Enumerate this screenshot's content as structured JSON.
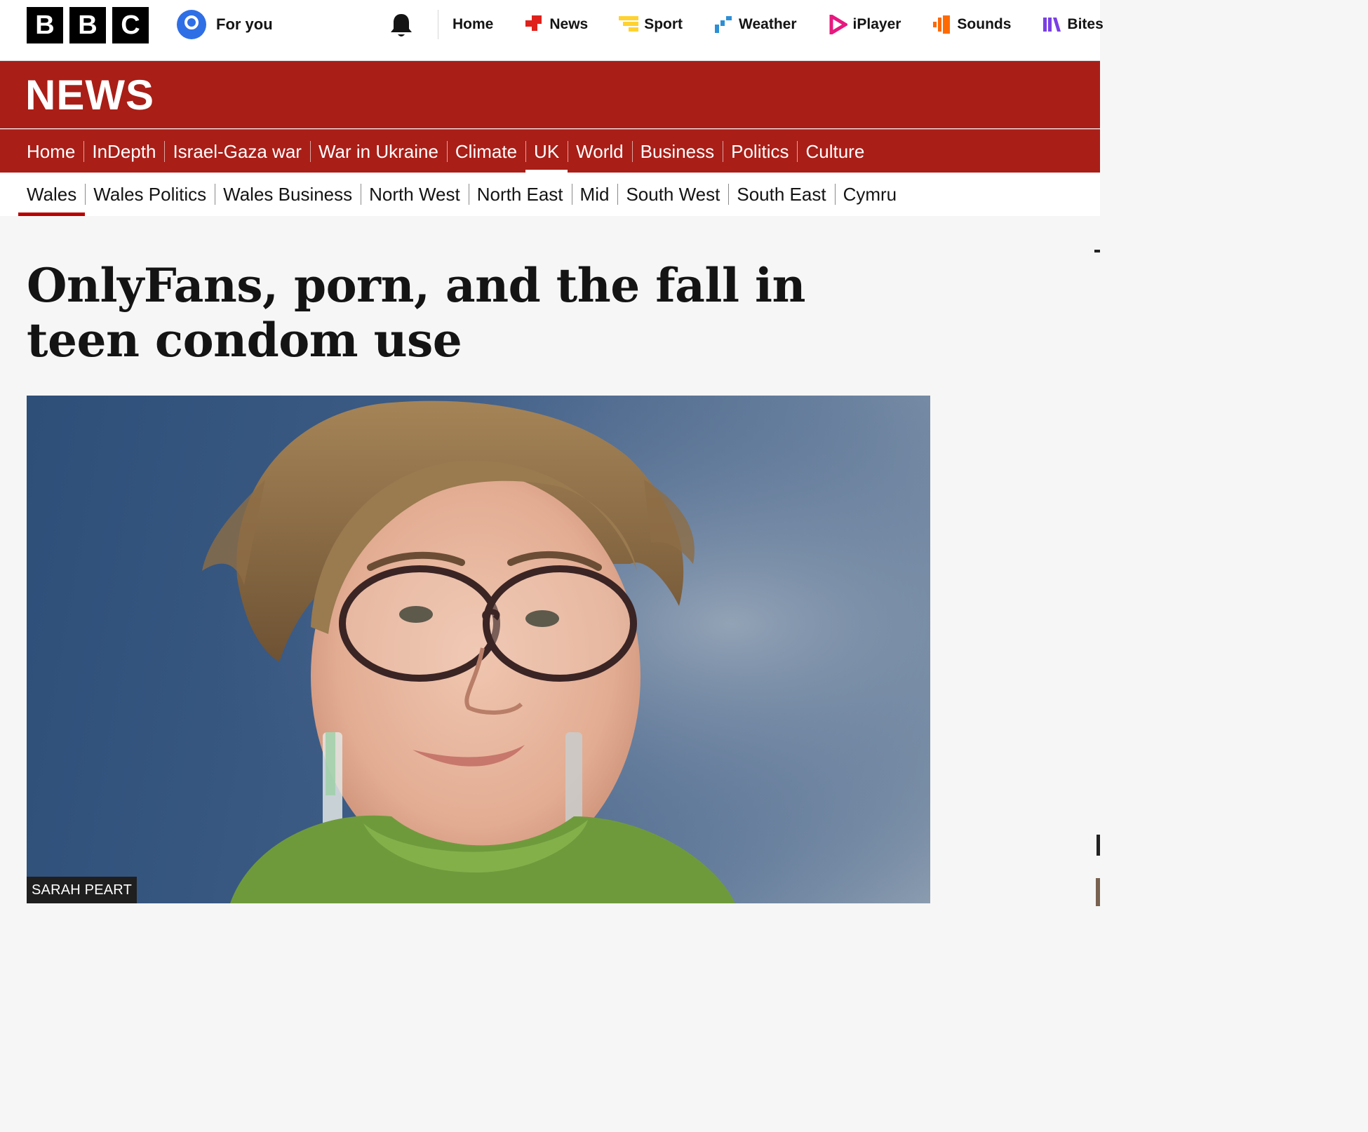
{
  "brand": {
    "letters": [
      "B",
      "B",
      "C"
    ]
  },
  "account": {
    "label": "For you"
  },
  "global_nav": [
    {
      "label": "Home",
      "icon": ""
    },
    {
      "label": "News",
      "icon": "news-icon"
    },
    {
      "label": "Sport",
      "icon": "sport-icon"
    },
    {
      "label": "Weather",
      "icon": "weather-icon"
    },
    {
      "label": "iPlayer",
      "icon": "iplayer-icon"
    },
    {
      "label": "Sounds",
      "icon": "sounds-icon"
    },
    {
      "label": "Bites",
      "icon": "bites-icon"
    }
  ],
  "section": {
    "title": "NEWS"
  },
  "news_nav": [
    {
      "label": "Home"
    },
    {
      "label": "InDepth"
    },
    {
      "label": "Israel-Gaza war"
    },
    {
      "label": "War in Ukraine"
    },
    {
      "label": "Climate"
    },
    {
      "label": "UK",
      "active": true
    },
    {
      "label": "World"
    },
    {
      "label": "Business"
    },
    {
      "label": "Politics"
    },
    {
      "label": "Culture"
    }
  ],
  "sub_nav": [
    {
      "label": "Wales",
      "active": true
    },
    {
      "label": "Wales Politics"
    },
    {
      "label": "Wales Business"
    },
    {
      "label": "North West"
    },
    {
      "label": "North East"
    },
    {
      "label": "Mid"
    },
    {
      "label": "South West"
    },
    {
      "label": "South East"
    },
    {
      "label": "Cymru"
    }
  ],
  "article": {
    "headline": "OnlyFans, porn, and the fall in teen condom use",
    "image_credit": "SARAH PEART"
  },
  "colors": {
    "brand_red": "#a91e17",
    "active_underline": "#b80000",
    "news_icon": "#e0211b",
    "sport_icon": "#ffd230",
    "weather_icon": "#2d8fd5",
    "iplayer_icon": "#e6197f",
    "sounds_icon": "#ff6a00",
    "bites_icon": "#7b3fe4",
    "account_icon": "#2f6fe6"
  }
}
